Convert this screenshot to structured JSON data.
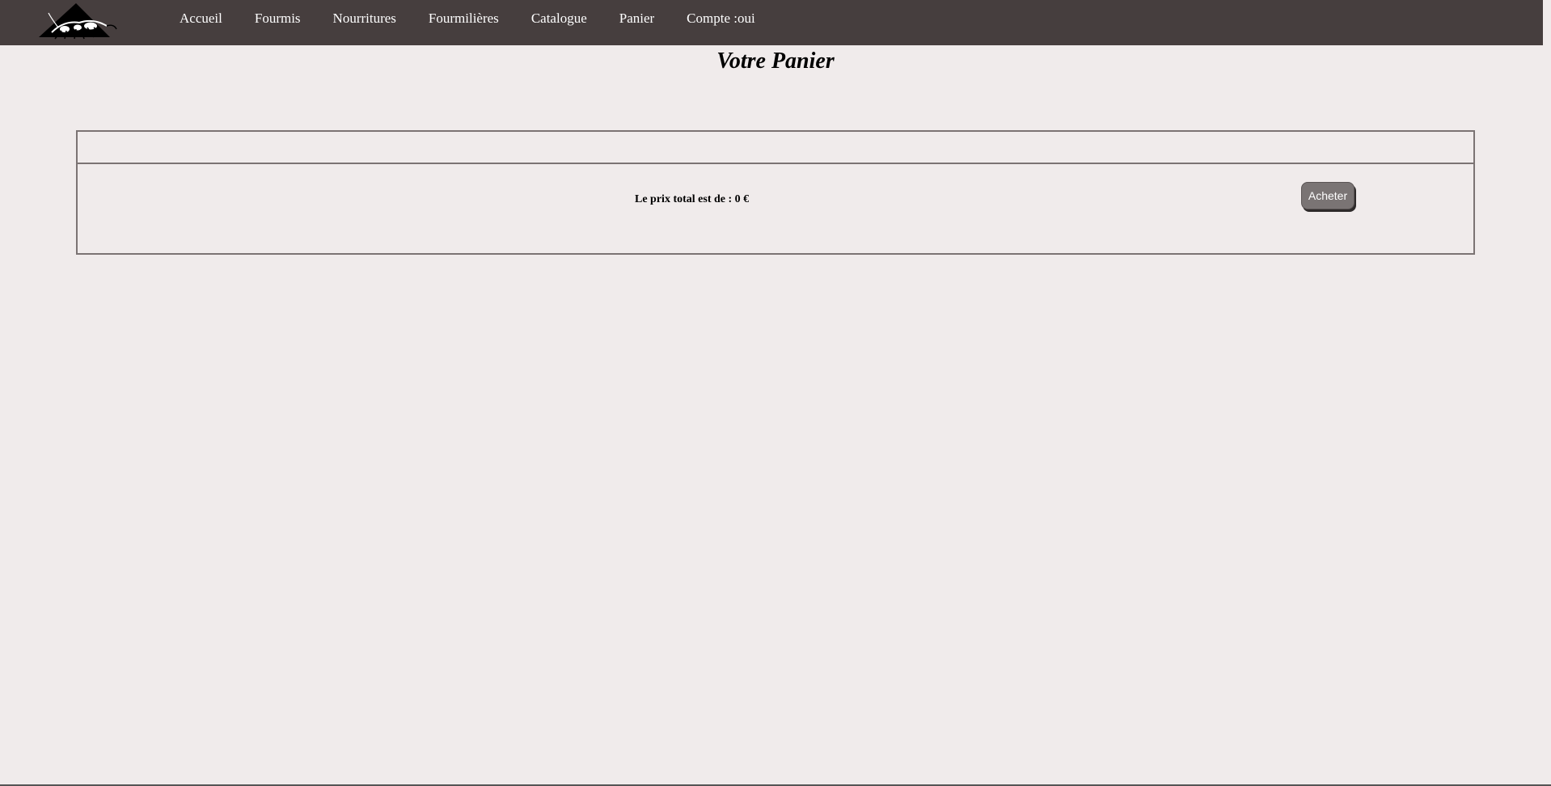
{
  "brand": {
    "logo_icon": "ant-logo-icon"
  },
  "nav": {
    "items": [
      {
        "label": "Accueil"
      },
      {
        "label": "Fourmis"
      },
      {
        "label": "Nourritures"
      },
      {
        "label": "Fourmilières"
      },
      {
        "label": "Catalogue"
      },
      {
        "label": "Panier"
      },
      {
        "label": "Compte :oui"
      }
    ]
  },
  "page": {
    "title": "Votre Panier"
  },
  "cart": {
    "total_text": "Le prix total est de : 0 €",
    "buy_label": "Acheter"
  },
  "colors": {
    "navbar": "#463e3e",
    "background": "#f0ebeb",
    "button": "#7a7474"
  }
}
